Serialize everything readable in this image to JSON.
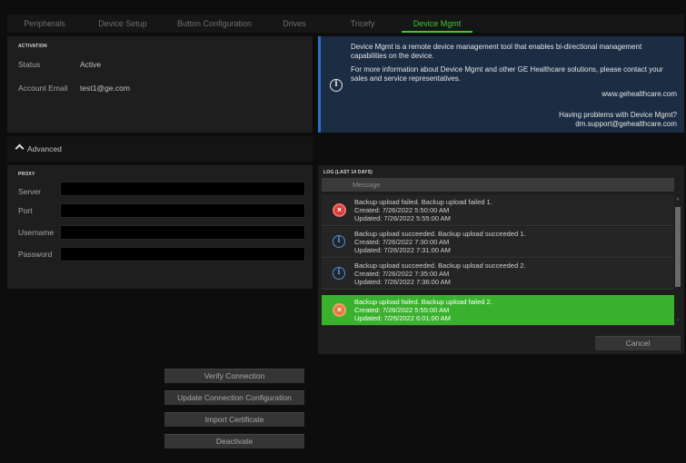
{
  "tabs": [
    {
      "label": "Peripherals",
      "active": false
    },
    {
      "label": "Device Setup",
      "active": false
    },
    {
      "label": "Button Configuration",
      "active": false
    },
    {
      "label": "Drives",
      "active": false
    },
    {
      "label": "Tricefy",
      "active": false
    },
    {
      "label": "Device Mgmt",
      "active": true
    }
  ],
  "activation": {
    "title": "ACTIVATION",
    "status_label": "Status",
    "status_value": "Active",
    "email_label": "Account Email",
    "email_value": "test1@ge.com"
  },
  "info": {
    "line1": "Device Mgmt is a remote device management tool that enables bi-directional management",
    "line2": "capabilities on the device.",
    "line3": "For more information about Device Mgmt and other GE Healthcare solutions, please contact your",
    "line4": "sales and service representatives.",
    "website": "www.gehealthcare.com",
    "problems": "Having problems with Device Mgmt?",
    "support_email": "dm.support@gehealthcare.com"
  },
  "advanced": {
    "label": "Advanced"
  },
  "proxy": {
    "title": "PROXY",
    "server_label": "Server",
    "port_label": "Port",
    "username_label": "Username",
    "password_label": "Password"
  },
  "log": {
    "title": "LOG (LAST 14 DAYS)",
    "column": "Message",
    "entries": [
      {
        "type": "error",
        "message": "Backup upload failed. Backup upload failed 1.",
        "created": "Created: 7/26/2022 5:50:00 AM",
        "updated": "Updated: 7/26/2022 5:55:00 AM"
      },
      {
        "type": "info",
        "message": "Backup upload succeeded. Backup upload succeeded 1.",
        "created": "Created: 7/26/2022 7:30:00 AM",
        "updated": "Updated: 7/26/2022 7:31:00 AM"
      },
      {
        "type": "info",
        "message": "Backup upload succeeded. Backup upload succeeded 2.",
        "created": "Created: 7/26/2022 7:35:00 AM",
        "updated": "Updated: 7/26/2022 7:36:00 AM"
      },
      {
        "type": "error",
        "message": "Backup upload failed. Backup upload failed 2.",
        "created": "Created: 7/26/2022 5:55:00 AM",
        "updated": "Updated: 7/26/2022 6:01:00 AM"
      }
    ],
    "cancel_label": "Cancel"
  },
  "buttons": {
    "verify": "Verify Connection",
    "update": "Update Connection Configuration",
    "import": "Import Certificate",
    "deactivate": "Deactivate"
  },
  "colors": {
    "accent": "#33cc33",
    "info_border": "#2b6fcf",
    "selected_row": "#3ab12d",
    "error": "#d93b3b"
  }
}
